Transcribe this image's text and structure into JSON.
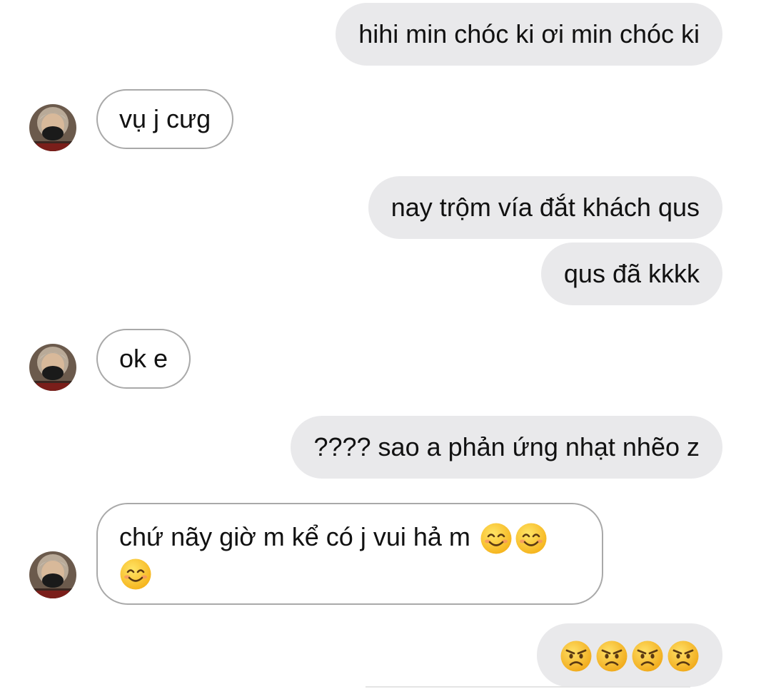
{
  "messages": [
    {
      "id": "m1",
      "direction": "sent",
      "text": "hihi min chóc ki ơi min chóc ki"
    },
    {
      "id": "m2",
      "direction": "received",
      "text": "vụ j cưg",
      "show_avatar": true
    },
    {
      "id": "m3",
      "direction": "sent",
      "text": "nay trộm vía đắt khách qus"
    },
    {
      "id": "m4",
      "direction": "sent",
      "text": "qus đã kkkk"
    },
    {
      "id": "m5",
      "direction": "received",
      "text": "ok e",
      "show_avatar": true
    },
    {
      "id": "m6",
      "direction": "sent",
      "text": "???? sao a phản ứng nhạt nhẽo z"
    },
    {
      "id": "m7",
      "direction": "received",
      "text": "chứ nãy giờ m kể có j vui hả m",
      "emojis": [
        "smiling-face-emoji",
        "smiling-face-emoji",
        "smiling-face-emoji"
      ],
      "show_avatar": true
    },
    {
      "id": "m8",
      "direction": "sent",
      "text": "",
      "emojis": [
        "angry-face-emoji",
        "angry-face-emoji",
        "angry-face-emoji",
        "angry-face-emoji"
      ]
    }
  ],
  "colors": {
    "sent_bubble": "#e9e9eb",
    "received_border": "#a9a9a9",
    "text": "#111111",
    "background": "#ffffff"
  }
}
